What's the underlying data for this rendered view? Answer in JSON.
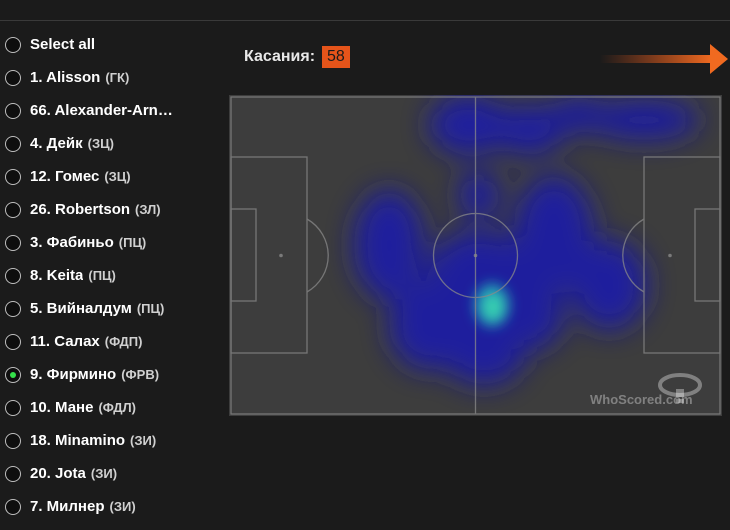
{
  "players": [
    {
      "name": "Select all",
      "position": "",
      "selected": false
    },
    {
      "name": "1. Alisson",
      "position": "(ГК)",
      "selected": false
    },
    {
      "name": "66. Alexander-Arn…",
      "position": "",
      "selected": false
    },
    {
      "name": "4. Дейк",
      "position": "(ЗЦ)",
      "selected": false
    },
    {
      "name": "12. Гомес",
      "position": "(ЗЦ)",
      "selected": false
    },
    {
      "name": "26. Robertson",
      "position": "(ЗЛ)",
      "selected": false
    },
    {
      "name": "3. Фабиньо",
      "position": "(ПЦ)",
      "selected": false
    },
    {
      "name": "8. Keita",
      "position": "(ПЦ)",
      "selected": false
    },
    {
      "name": "5. Вийналдум",
      "position": "(ПЦ)",
      "selected": false
    },
    {
      "name": "11. Салах",
      "position": "(ФДП)",
      "selected": false
    },
    {
      "name": "9. Фирмино",
      "position": "(ФРВ)",
      "selected": true
    },
    {
      "name": "10. Мане",
      "position": "(ФДЛ)",
      "selected": false
    },
    {
      "name": "18. Minamino",
      "position": "(ЗИ)",
      "selected": false
    },
    {
      "name": "20. Jota",
      "position": "(ЗИ)",
      "selected": false
    },
    {
      "name": "7. Милнер",
      "position": "(ЗИ)",
      "selected": false
    }
  ],
  "touches": {
    "label": "Касания:",
    "value": "58"
  },
  "watermark": "WhoScored.com",
  "icons": {
    "next": "arrow-right-icon",
    "logo": "whoscored-logo-icon"
  },
  "colors": {
    "background": "#1b1b1b",
    "accent": "#e5541a",
    "selected_radio": "#34e04a",
    "pitch": "#3d3d3d",
    "heat_low": "#1a1aa0",
    "heat_high": "#2fd7a8"
  }
}
